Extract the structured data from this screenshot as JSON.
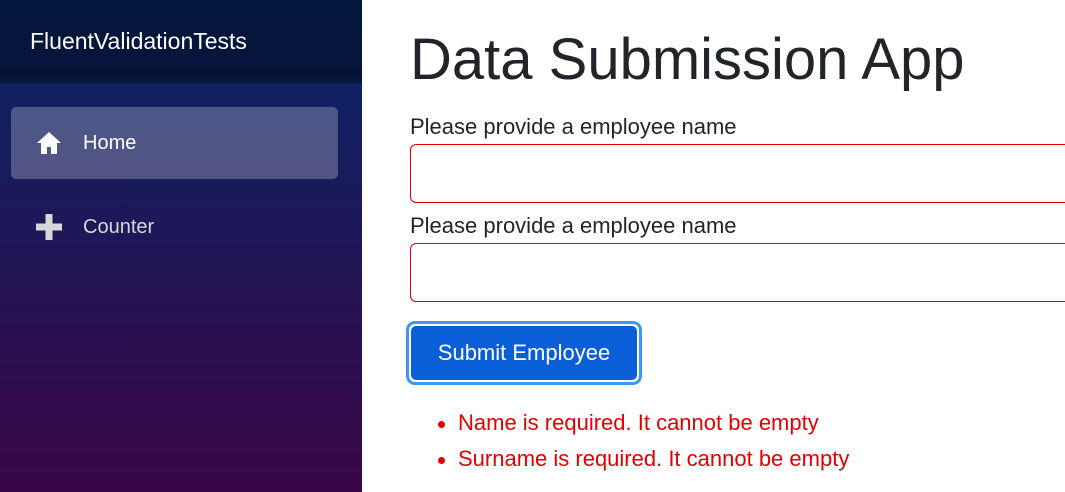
{
  "sidebar": {
    "brand": "FluentValidationTests",
    "items": [
      {
        "label": "Home",
        "icon": "home-icon",
        "active": true
      },
      {
        "label": "Counter",
        "icon": "plus-icon",
        "active": false
      }
    ]
  },
  "main": {
    "title": "Data Submission App",
    "fields": [
      {
        "label": "Please provide a employee name",
        "value": ""
      },
      {
        "label": "Please provide a employee name",
        "value": ""
      }
    ],
    "submit_label": "Submit Employee",
    "errors": [
      "Name is required. It cannot be empty",
      "Surname is required. It cannot be empty"
    ]
  },
  "colors": {
    "sidebar_top": "#052767",
    "sidebar_bottom": "#3a0647",
    "error": "#e50000",
    "button": "#0a5ed7",
    "button_focus": "#3a97f5"
  }
}
